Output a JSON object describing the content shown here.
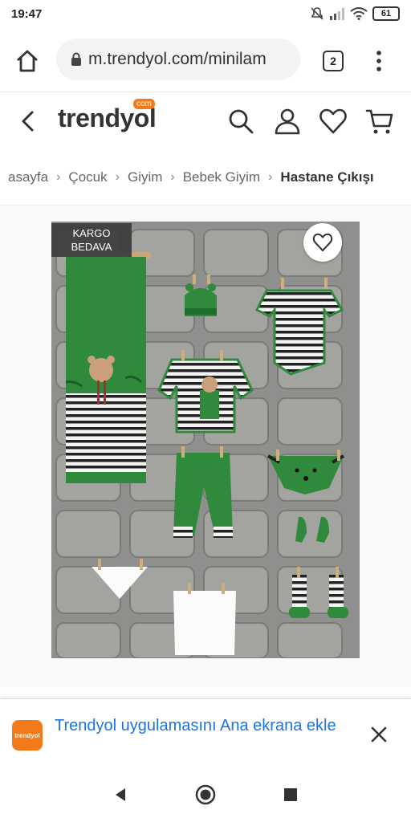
{
  "status_bar": {
    "time": "19:47",
    "battery": "61",
    "icons": [
      "mute-icon",
      "signal-icon",
      "wifi-icon",
      "battery-icon"
    ]
  },
  "browser": {
    "url": "m.trendyol.com/minilam",
    "tab_count": "2"
  },
  "site_header": {
    "logo_text": "trendyol",
    "logo_badge": "com",
    "brand_color": "#f27a1a"
  },
  "breadcrumb": {
    "items": [
      "asayfa",
      "Çocuk",
      "Giyim",
      "Bebek Giyim",
      "Hastane Çıkışı"
    ]
  },
  "product": {
    "badge_line1": "KARGO",
    "badge_line2": "BEDAVA"
  },
  "install_banner": {
    "app_icon_label": "trendyol",
    "text": "Trendyol uygulamasını Ana ekrana ekle",
    "link_color": "#1a73e8"
  }
}
